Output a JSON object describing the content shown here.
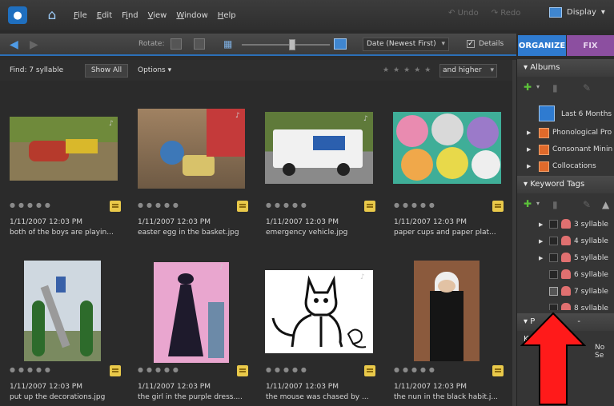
{
  "menubar": {
    "items": [
      {
        "u": "F",
        "rest": "ile"
      },
      {
        "u": "E",
        "rest": "dit"
      },
      {
        "pre": "F",
        "u": "i",
        "rest": "nd"
      },
      {
        "u": "V",
        "rest": "iew"
      },
      {
        "u": "W",
        "rest": "indow"
      },
      {
        "u": "H",
        "rest": "elp"
      }
    ],
    "undo": "Undo",
    "redo": "Redo",
    "display": "Display"
  },
  "toolbar": {
    "rotate_label": "Rotate:",
    "sort": "Date (Newest First)",
    "details": "Details"
  },
  "tabs": {
    "organize": "ORGANIZE",
    "fix": "FIX"
  },
  "findbar": {
    "find_label": "Find: 7 syllable",
    "show_all": "Show All",
    "options": "Options",
    "higher": "and higher"
  },
  "photos": [
    {
      "date": "1/11/2007 12:03 PM",
      "name": "both of the boys are playin...",
      "colors": [
        "#6f8a3b",
        "#b63a2c"
      ]
    },
    {
      "date": "1/11/2007 12:03 PM",
      "name": "easter egg in the basket.jpg",
      "colors": [
        "#8a6a48",
        "#3d78b8"
      ]
    },
    {
      "date": "1/11/2007 12:03 PM",
      "name": "emergency vehicle.jpg",
      "colors": [
        "#5f7a3a",
        "#f1f1f1"
      ]
    },
    {
      "date": "1/11/2007 12:03 PM",
      "name": "paper cups and paper plat...",
      "colors": [
        "#3fae98",
        "#e8d94a"
      ]
    },
    {
      "date": "1/11/2007 12:03 PM",
      "name": "put up the decorations.jpg",
      "colors": [
        "#cfd8e0",
        "#2d6b2b"
      ]
    },
    {
      "date": "1/11/2007 12:03 PM",
      "name": "the girl in the purple dress....",
      "colors": [
        "#e9a6cf",
        "#1e1a2c"
      ]
    },
    {
      "date": "1/11/2007 12:03 PM",
      "name": "the mouse was chased by ...",
      "colors": [
        "#ffffff",
        "#111111"
      ]
    },
    {
      "date": "1/11/2007 12:03 PM",
      "name": "the nun in the black habit.j...",
      "colors": [
        "#8b5a3d",
        "#151515"
      ]
    }
  ],
  "albums": {
    "title": "Albums",
    "items": [
      "Last 6 Months",
      "Phonological Pro",
      "Consonant Minin",
      "Collocations"
    ]
  },
  "keywords": {
    "title": "Keyword Tags",
    "items": [
      "3 syllable",
      "4 syllable",
      "5 syllable",
      "6 syllable",
      "7 syllable",
      "8 syllable"
    ]
  },
  "bottom_panel": {
    "title_a": "P",
    "title_b": "- Keyword",
    "no_sel": "No Se"
  }
}
